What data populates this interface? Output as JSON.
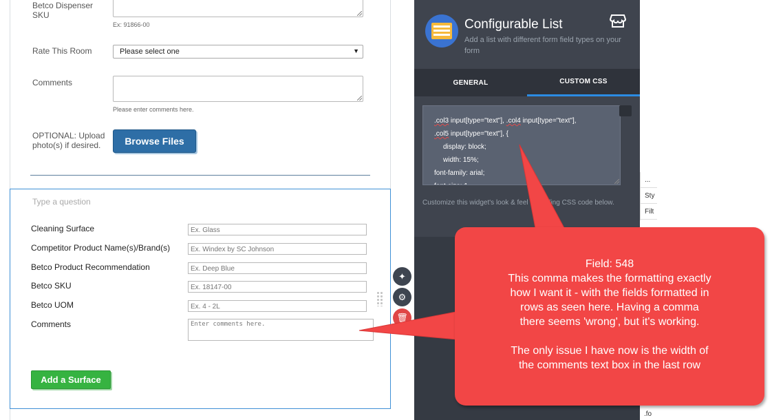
{
  "form": {
    "dispenser_sku": {
      "label_line1": "Betco Dispenser",
      "label_line2": "SKU",
      "hint": "Ex: 91866-00"
    },
    "rate_room": {
      "label": "Rate This Room",
      "selected": "Please select one"
    },
    "comments": {
      "label": "Comments",
      "hint": "Please enter comments here."
    },
    "upload": {
      "label_line1": "OPTIONAL: Upload",
      "label_line2": "photo(s) if desired.",
      "button": "Browse Files"
    }
  },
  "config_list": {
    "question_placeholder": "Type a question",
    "rows": [
      {
        "label": "Cleaning Surface",
        "placeholder": "Ex. Glass"
      },
      {
        "label": "Competitor Product Name(s)/Brand(s)",
        "placeholder": "Ex. Windex by SC Johnson"
      },
      {
        "label": "Betco Product Recommendation",
        "placeholder": "Ex. Deep Blue"
      },
      {
        "label": "Betco SKU",
        "placeholder": "Ex. 18147-00"
      },
      {
        "label": "Betco UOM",
        "placeholder": "Ex. 4 - 2L"
      }
    ],
    "comments_label": "Comments",
    "comments_placeholder": "Enter comments here.",
    "add_button": "Add a Surface",
    "tool_icons": [
      "wand-icon",
      "gear-icon",
      "trash-icon"
    ]
  },
  "panel": {
    "title": "Configurable List",
    "subtitle": "Add a list with different form field types on your form",
    "corner_icon": "store-icon",
    "tabs": [
      "GENERAL",
      "CUSTOM CSS"
    ],
    "active_tab": "CUSTOM CSS",
    "code": {
      "line1_a": ".col3",
      "line1_b": " input[type=\"text\"], ",
      "line1_c": ".col4",
      "line1_d": " input[type=\"text\"],",
      "line2_a": ".col5",
      "line2_b": " input[type=\"text\"], {",
      "line3": "display: block;",
      "line4": "width: 15%;",
      "line5": "font-family: arial;",
      "line6": "font-size: 1..."
    },
    "description": "Customize this widget's look & feel by adding CSS code below."
  },
  "devtools_peek": {
    "dots": "...",
    "tab": "Sty",
    "filter": "Filt",
    "bottom": ".fo"
  },
  "callout": {
    "title": "Field: 548",
    "line1": "This comma makes the formatting exactly",
    "line2": "how I want it - with the fields formatted in",
    "line3": "rows as seen here. Having a comma",
    "line4": "there seems 'wrong', but it's working.",
    "line5": "The only issue I have now is the width of",
    "line6": "the comments text box in the last row",
    "color": "#f24646"
  }
}
